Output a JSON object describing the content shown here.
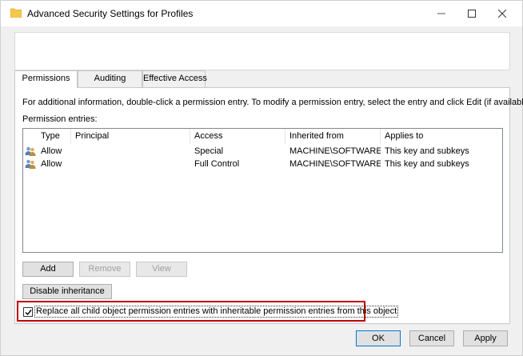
{
  "window": {
    "title": "Advanced Security Settings for Profiles",
    "controls": {
      "minimize": "—",
      "maximize": "☐",
      "close": "✕"
    }
  },
  "tabs": [
    {
      "label": "Permissions",
      "active": true
    },
    {
      "label": "Auditing",
      "active": false
    },
    {
      "label": "Effective Access",
      "active": false
    }
  ],
  "permissions": {
    "info": "For additional information, double-click a permission entry. To modify a permission entry, select the entry and click Edit (if available).",
    "entries_label": "Permission entries:",
    "columns": [
      "Type",
      "Principal",
      "Access",
      "Inherited from",
      "Applies to"
    ],
    "rows": [
      {
        "icon": "users-icon",
        "type": "Allow",
        "principal": "",
        "access": "Special",
        "inherited_from": "MACHINE\\SOFTWARE...",
        "applies_to": "This key and subkeys"
      },
      {
        "icon": "users-icon",
        "type": "Allow",
        "principal": "",
        "access": "Full Control",
        "inherited_from": "MACHINE\\SOFTWARE...",
        "applies_to": "This key and subkeys"
      }
    ],
    "buttons": {
      "add": {
        "label": "Add",
        "enabled": true
      },
      "remove": {
        "label": "Remove",
        "enabled": false
      },
      "view": {
        "label": "View",
        "enabled": false
      },
      "disable_inheritance": {
        "label": "Disable inheritance",
        "enabled": true
      }
    },
    "replace_child": {
      "label": "Replace all child object permission entries with inheritable permission entries from this object",
      "checked": true,
      "highlight_color": "#c00000"
    }
  },
  "footer": {
    "ok": "OK",
    "cancel": "Cancel",
    "apply": "Apply"
  },
  "colors": {
    "accent": "#0078d7",
    "highlight": "#c00000"
  }
}
